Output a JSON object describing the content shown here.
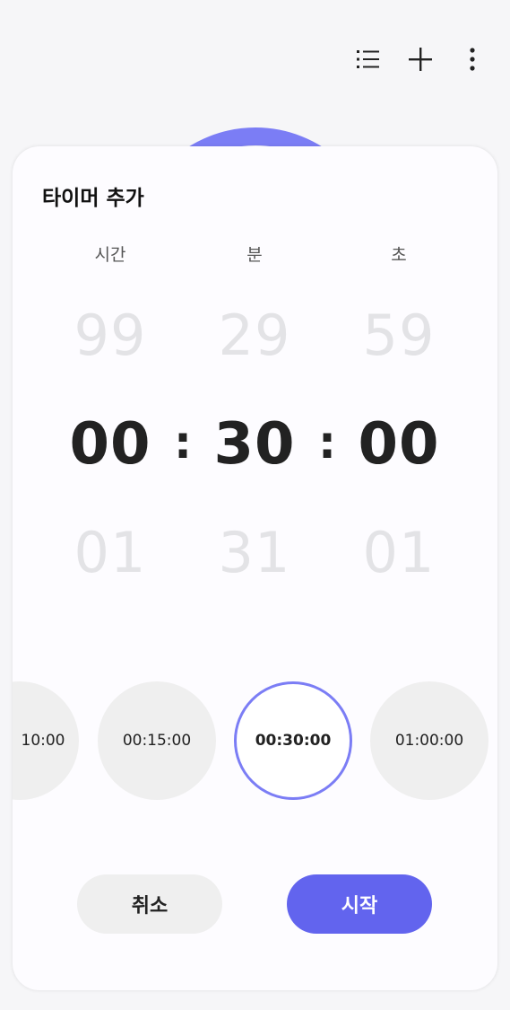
{
  "topbar": {
    "icons": [
      "list-icon",
      "plus-icon",
      "more-vert-icon"
    ]
  },
  "sheet": {
    "title": "타이머 추가",
    "columns": {
      "hours_label": "시간",
      "minutes_label": "분",
      "seconds_label": "초"
    },
    "picker": {
      "hours": {
        "prev": "99",
        "current": "00",
        "next": "01"
      },
      "minutes": {
        "prev": "29",
        "current": "30",
        "next": "31"
      },
      "seconds": {
        "prev": "59",
        "current": "00",
        "next": "01"
      },
      "separator": ":"
    },
    "presets": [
      {
        "label": "10:00",
        "active": false
      },
      {
        "label": "00:15:00",
        "active": false
      },
      {
        "label": "00:30:00",
        "active": true
      },
      {
        "label": "01:00:00",
        "active": false
      }
    ],
    "buttons": {
      "cancel": "취소",
      "start": "시작"
    }
  },
  "colors": {
    "accent": "#6264ee",
    "ring": "#7b7df5",
    "background": "#f6f6f8",
    "chip": "#efefef"
  }
}
